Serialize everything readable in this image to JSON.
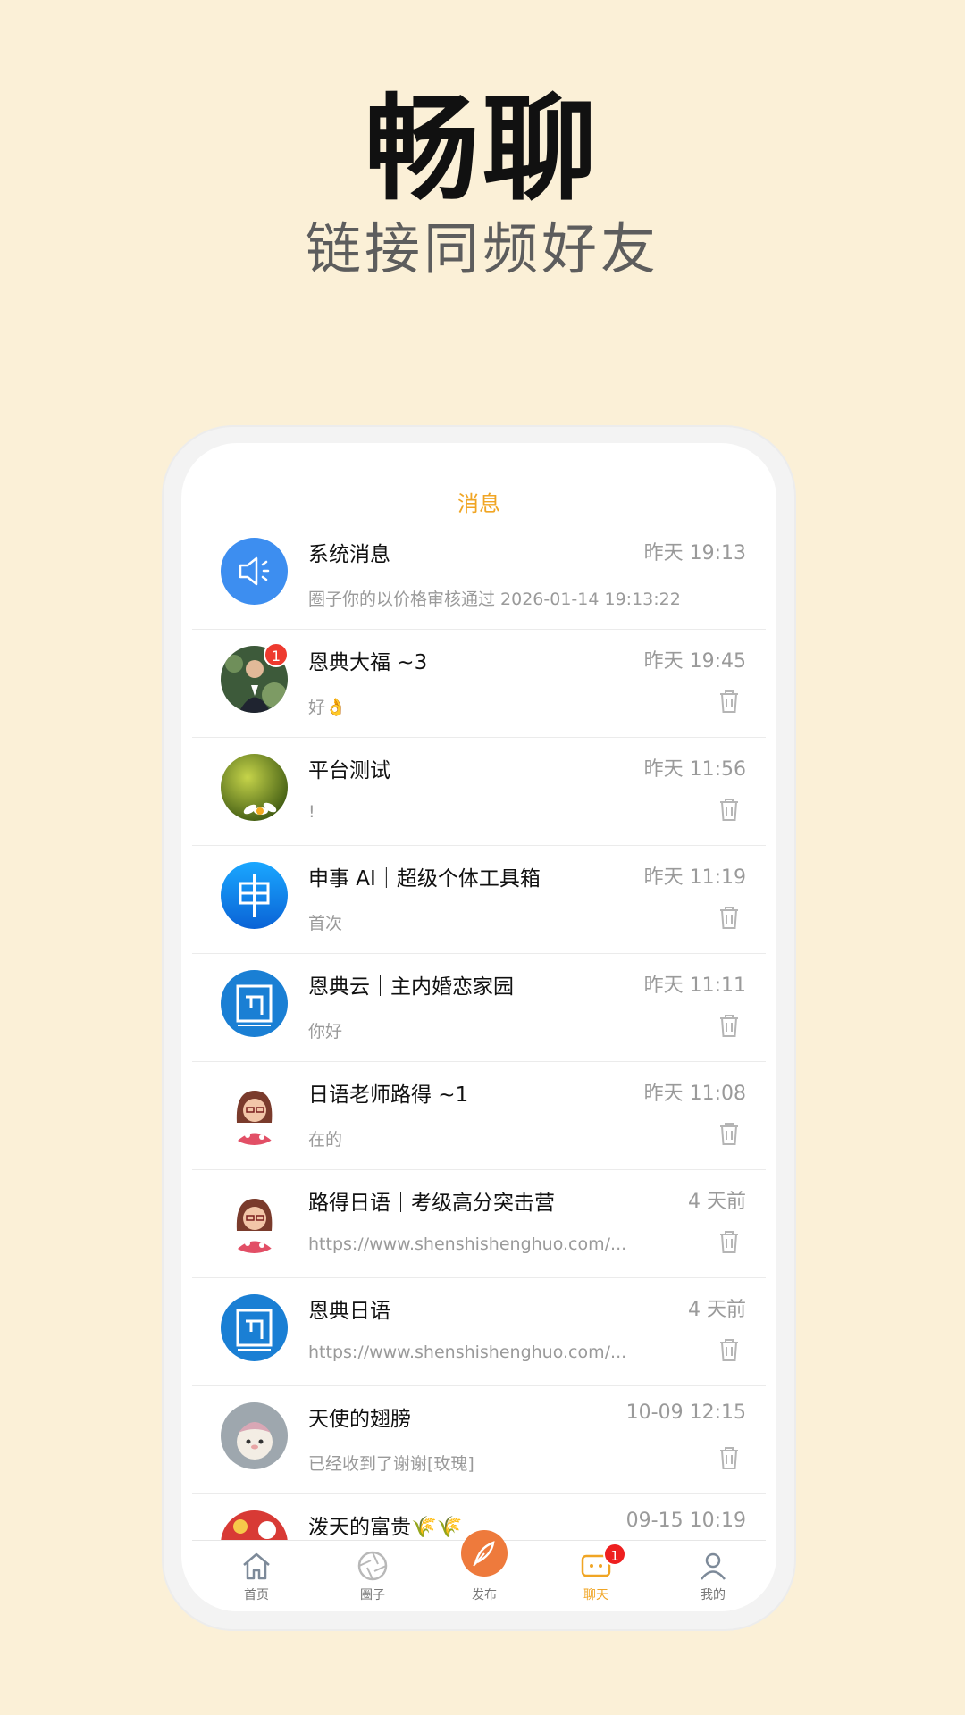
{
  "promo": {
    "headline": "畅聊",
    "subheadline": "链接同频好友"
  },
  "screen": {
    "title": "消息"
  },
  "conversations": [
    {
      "name": "系统消息",
      "time": "昨天 19:13",
      "preview": "圈子你的以价格审核通过 2026-01-14 19:13:22",
      "avatar": "speaker-icon",
      "badge": null
    },
    {
      "name": "恩典大福 ~3",
      "time": "昨天 19:45",
      "preview": "好👌",
      "avatar": "user-photo",
      "badge": "1"
    },
    {
      "name": "平台测试",
      "time": "昨天 11:56",
      "preview": "!",
      "avatar": "flower-photo",
      "badge": null
    },
    {
      "name": "申事 AI｜超级个体工具箱",
      "time": "昨天 11:19",
      "preview": "首次",
      "avatar": "shen-logo",
      "badge": null
    },
    {
      "name": "恩典云｜主内婚恋家园",
      "time": "昨天 11:11",
      "preview": "你好",
      "avatar": "endian-logo",
      "badge": null
    },
    {
      "name": "日语老师路得 ~1",
      "time": "昨天 11:08",
      "preview": "在的",
      "avatar": "teacher-photo",
      "badge": null
    },
    {
      "name": "路得日语｜考级高分突击营",
      "time": "4 天前",
      "preview": "https://www.shenshishenghuo.com/...",
      "avatar": "teacher-photo",
      "badge": null
    },
    {
      "name": "恩典日语",
      "time": "4 天前",
      "preview": "https://www.shenshishenghuo.com/...",
      "avatar": "endian-logo",
      "badge": null
    },
    {
      "name": "天使的翅膀",
      "time": "10-09 12:15",
      "preview": "已经收到了谢谢[玫瑰]",
      "avatar": "lamb-photo",
      "badge": null
    },
    {
      "name": "泼天的富贵🌾🌾",
      "time": "09-15 10:19",
      "preview": "",
      "avatar": "festive-photo",
      "badge": null
    }
  ],
  "tabs": [
    {
      "label": "首页",
      "icon": "home-icon"
    },
    {
      "label": "圈子",
      "icon": "aperture-icon"
    },
    {
      "label": "发布",
      "icon": "feather-icon"
    },
    {
      "label": "聊天",
      "icon": "chat-icon",
      "badge": "1",
      "active": true
    },
    {
      "label": "我的",
      "icon": "user-icon"
    }
  ],
  "colors": {
    "background": "#fbf0d7",
    "accent": "#f0a524",
    "badge": "#ee3a2f"
  }
}
